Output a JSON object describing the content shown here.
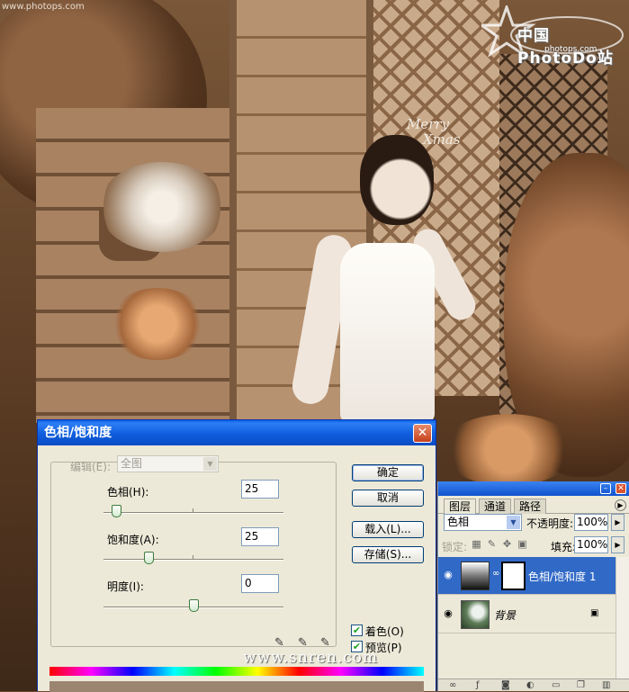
{
  "watermarks": {
    "top_left": "www.photops.com",
    "logo_text": "中国PhotoDo站",
    "logo_sub": "photops.com",
    "bottom_center": "www.snren.com"
  },
  "photo": {
    "sign_line1": "Merry",
    "sign_line2": "Xmas"
  },
  "dialog": {
    "title": "色相/饱和度",
    "close_label": "✕",
    "edit_label": "编辑(E):",
    "edit_value": "全图",
    "hue_label": "色相(H):",
    "hue_value": "25",
    "hue_position": 0.07,
    "saturation_label": "饱和度(A):",
    "saturation_value": "25",
    "saturation_position": 0.25,
    "lightness_label": "明度(I):",
    "lightness_value": "0",
    "lightness_position": 0.5,
    "buttons": {
      "ok": "确定",
      "cancel": "取消",
      "load": "载入(L)...",
      "save": "存储(S)..."
    },
    "colorize_label": "着色(O)",
    "colorize_checked": true,
    "preview_label": "预览(P)",
    "preview_checked": true,
    "colorize_color": "#9c8570"
  },
  "layers_panel": {
    "tabs": [
      "图层",
      "通道",
      "路径"
    ],
    "active_tab": "图层",
    "blend_mode": "色相",
    "opacity_label": "不透明度:",
    "opacity_value": "100%",
    "lock_label": "锁定:",
    "fill_label": "填充:",
    "fill_value": "100%",
    "layers": [
      {
        "name": "色相/饱和度 1",
        "selected": true
      },
      {
        "name": "背景",
        "selected": false
      }
    ]
  }
}
